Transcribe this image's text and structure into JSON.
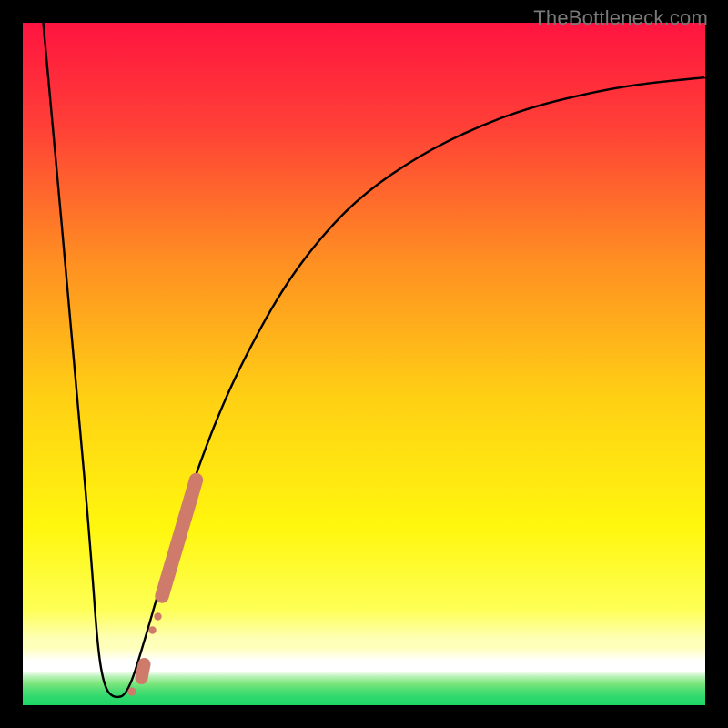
{
  "watermark": "TheBottleneck.com",
  "colors": {
    "curve_stroke": "#000000",
    "marker_fill": "#cf7b6b",
    "background_black": "#000000",
    "gradient_top": "#ff1440",
    "gradient_band1": "#ff5a33",
    "gradient_band2": "#ffa41f",
    "gradient_band3": "#ffe712",
    "gradient_yellow_pale": "#feff76",
    "gradient_green1": "#7fe87f",
    "gradient_green2": "#3ddc6f",
    "gradient_green3": "#1cd765"
  },
  "chart_data": {
    "type": "line",
    "title": "",
    "xlabel": "",
    "ylabel": "",
    "xlim": [
      0,
      100
    ],
    "ylim": [
      0,
      100
    ],
    "curve": [
      [
        3.0,
        100.0
      ],
      [
        8.3,
        42.0
      ],
      [
        10.0,
        22.0
      ],
      [
        11.0,
        8.0
      ],
      [
        12.0,
        2.5
      ],
      [
        13.4,
        1.0
      ],
      [
        15.4,
        1.6
      ],
      [
        18.0,
        10.0
      ],
      [
        20.0,
        17.0
      ],
      [
        24.0,
        30.0
      ],
      [
        28.0,
        41.0
      ],
      [
        32.0,
        50.0
      ],
      [
        38.0,
        61.0
      ],
      [
        44.0,
        69.0
      ],
      [
        50.0,
        75.0
      ],
      [
        58.0,
        80.5
      ],
      [
        66.0,
        84.5
      ],
      [
        74.0,
        87.5
      ],
      [
        82.0,
        89.5
      ],
      [
        90.0,
        91.0
      ],
      [
        100.0,
        92.0
      ]
    ],
    "markers": [
      {
        "x": 16.0,
        "y": 2.0,
        "r": 1.1
      },
      {
        "x": 17.4,
        "y": 4.0,
        "r": 2.0,
        "to_x": 17.8,
        "to_y": 6.0
      },
      {
        "x": 19.0,
        "y": 11.0,
        "r": 1.0
      },
      {
        "x": 19.8,
        "y": 13.0,
        "r": 1.0
      },
      {
        "x": 20.4,
        "y": 16.0,
        "r": 2.2,
        "to_x": 25.4,
        "to_y": 33.0
      }
    ]
  }
}
